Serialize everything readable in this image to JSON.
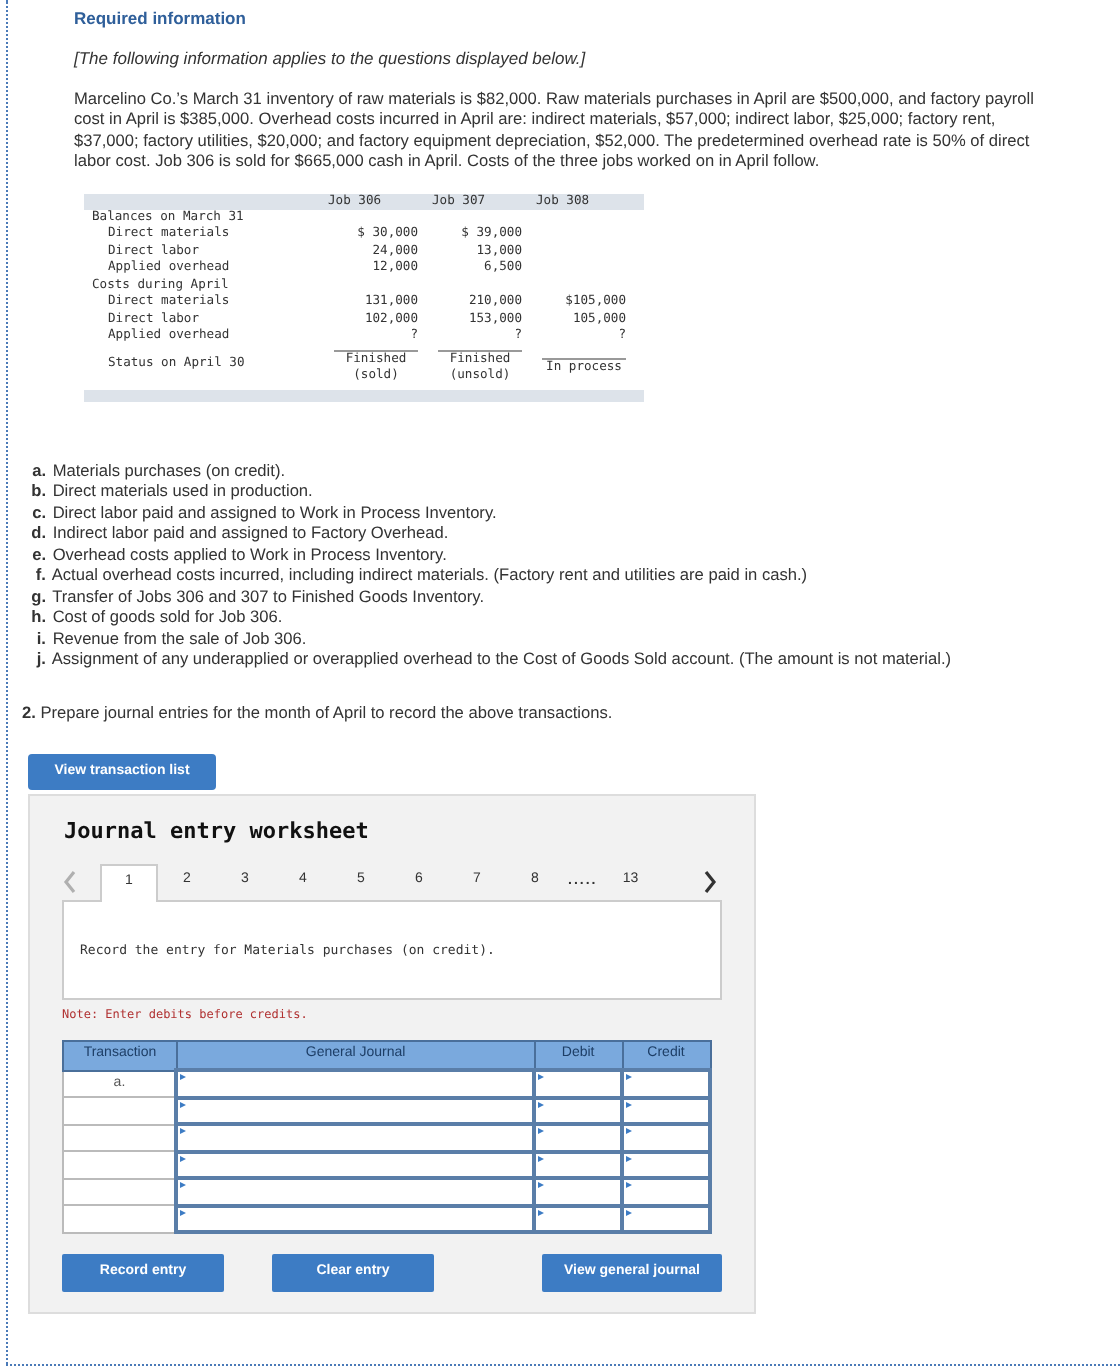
{
  "heading": "Required information",
  "intro_note": "[The following information applies to the questions displayed below.]",
  "paragraph": "Marcelino Co.’s March 31 inventory of raw materials is $82,000. Raw materials purchases in April are $500,000, and factory payroll cost in April is $385,000. Overhead costs incurred in April are: indirect materials, $57,000; indirect labor, $25,000; factory rent, $37,000; factory utilities, $20,000; and factory equipment depreciation, $52,000. The predetermined overhead rate is 50% of direct labor cost. Job 306 is sold for $665,000 cash in April. Costs of the three jobs worked on in April follow.",
  "job_table": {
    "columns": [
      "Job 306",
      "Job 307",
      "Job 308"
    ],
    "rows": [
      {
        "kind": "section",
        "label": "Balances on March 31",
        "values": []
      },
      {
        "kind": "item",
        "label": "Direct materials",
        "values": [
          "$ 30,000",
          "$ 39,000"
        ]
      },
      {
        "kind": "item",
        "label": "Direct labor",
        "values": [
          "24,000",
          "13,000"
        ]
      },
      {
        "kind": "item",
        "label": "Applied overhead",
        "values": [
          "12,000",
          "6,500"
        ]
      },
      {
        "kind": "section",
        "label": "Costs during April",
        "values": []
      },
      {
        "kind": "item",
        "label": "Direct materials",
        "values": [
          "131,000",
          "210,000",
          "$105,000"
        ]
      },
      {
        "kind": "item",
        "label": "Direct labor",
        "values": [
          "102,000",
          "153,000",
          "105,000"
        ]
      },
      {
        "kind": "item",
        "label": "Applied overhead",
        "values": [
          "?",
          "?",
          "?"
        ]
      },
      {
        "kind": "status",
        "label": "Status on April 30",
        "values": [
          "Finished\n(sold)",
          "Finished\n(unsold)",
          "In process"
        ]
      }
    ]
  },
  "transactions": [
    {
      "letter": "a.",
      "text": "Materials purchases (on credit)."
    },
    {
      "letter": "b.",
      "text": "Direct materials used in production."
    },
    {
      "letter": "c.",
      "text": "Direct labor paid and assigned to Work in Process Inventory."
    },
    {
      "letter": "d.",
      "text": "Indirect labor paid and assigned to Factory Overhead."
    },
    {
      "letter": "e.",
      "text": "Overhead costs applied to Work in Process Inventory."
    },
    {
      "letter": "f.",
      "text": "Actual overhead costs incurred, including indirect materials. (Factory rent and utilities are paid in cash.)"
    },
    {
      "letter": "g.",
      "text": "Transfer of Jobs 306 and 307 to Finished Goods Inventory."
    },
    {
      "letter": "h.",
      "text": "Cost of goods sold for Job 306."
    },
    {
      "letter": "i.",
      "text": "Revenue from the sale of Job 306."
    },
    {
      "letter": "j.",
      "text": "Assignment of any underapplied or overapplied overhead to the Cost of Goods Sold account. (The amount is not material.)"
    }
  ],
  "question": {
    "number": "2.",
    "text": "Prepare journal entries for the month of April to record the above transactions."
  },
  "view_list_button": "View transaction list",
  "worksheet": {
    "title": "Journal entry worksheet",
    "prev_disabled": true,
    "next_disabled": false,
    "tabs": [
      {
        "kind": "tab",
        "label": "1",
        "selected": true
      },
      {
        "kind": "tab",
        "label": "2",
        "selected": false
      },
      {
        "kind": "tab",
        "label": "3",
        "selected": false
      },
      {
        "kind": "tab",
        "label": "4",
        "selected": false
      },
      {
        "kind": "tab",
        "label": "5",
        "selected": false
      },
      {
        "kind": "tab",
        "label": "6",
        "selected": false
      },
      {
        "kind": "tab",
        "label": "7",
        "selected": false
      },
      {
        "kind": "tab",
        "label": "8",
        "selected": false
      },
      {
        "kind": "gap",
        "label": "....."
      },
      {
        "kind": "tab",
        "label": "13",
        "selected": false
      }
    ],
    "instruction": "Record the entry for Materials purchases (on credit).",
    "note": "Note: Enter debits before credits.",
    "columns": [
      "Transaction",
      "General Journal",
      "Debit",
      "Credit"
    ],
    "rows": [
      {
        "transaction": "a."
      },
      {
        "transaction": null
      },
      {
        "transaction": null
      },
      {
        "transaction": null
      },
      {
        "transaction": null
      },
      {
        "transaction": null
      }
    ],
    "buttons": [
      "Record entry",
      "Clear entry",
      "View general journal"
    ]
  }
}
